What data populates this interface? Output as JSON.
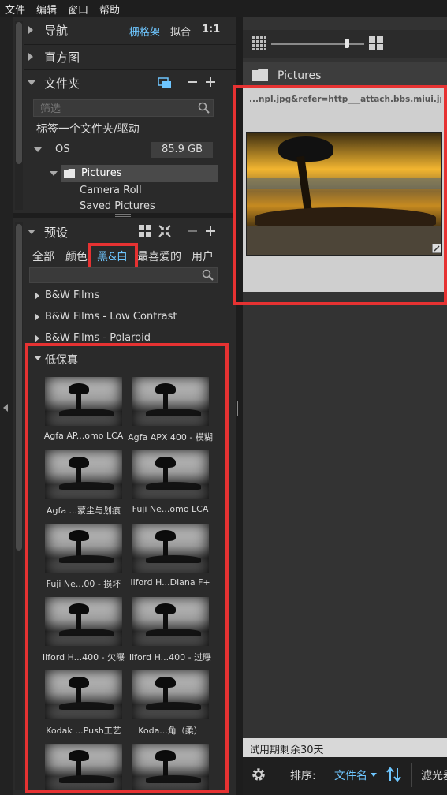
{
  "menubar": {
    "items": [
      "文件",
      "编辑",
      "窗口",
      "帮助"
    ]
  },
  "navigator": {
    "label": "导航",
    "fit_grid": "栅格架",
    "fit": "拟合",
    "ratio": "1:1"
  },
  "histogram": {
    "label": "直方图"
  },
  "folders": {
    "label": "文件夹",
    "filter_placeholder": "筛选",
    "tag_folder": "标签一个文件夹/驱动",
    "drive_name": "OS",
    "drive_size": "85.9 GB",
    "tree": [
      {
        "label": "Pictures",
        "selected": true
      },
      {
        "label": "Camera Roll"
      },
      {
        "label": "Saved Pictures"
      }
    ]
  },
  "presets": {
    "label": "预设",
    "tabs": [
      "全部",
      "颜色",
      "黑&白",
      "最喜爱的",
      "用户"
    ],
    "active_tab": "黑&白",
    "categories": [
      "B&W Films",
      "B&W Films - Low Contrast",
      "B&W Films - Polaroid"
    ],
    "expanded_category": "低保真",
    "items": [
      "Agfa AP...omo LCA",
      "Agfa APX 400 - 模糊",
      "Agfa ...蒙尘与划痕",
      "Fuji Ne...omo LCA",
      "Fuji Ne...00 - 损坏",
      "Ilford H...Diana F+",
      "Ilford H...400 - 欠曝",
      "Ilford H...400 - 过曝",
      "Kodak ...Push工艺",
      "Koda...角（柔）",
      "",
      ""
    ]
  },
  "browser": {
    "folder_title": "Pictures",
    "image_name": "...npl.jpg&refer=http___attach.bbs.miui.jpg",
    "trial_text": "试用期剩余30天",
    "sort_label": "排序:",
    "sort_value": "文件名",
    "filter_label": "滤光器"
  },
  "colors": {
    "highlight": "#e63232",
    "accent": "#6ec6ff"
  }
}
